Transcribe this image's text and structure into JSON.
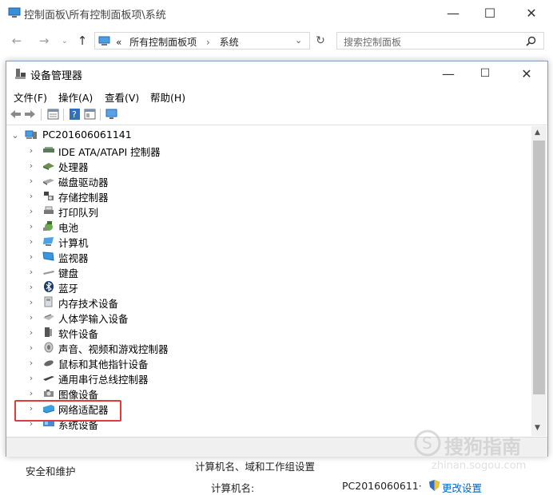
{
  "outer_window": {
    "title": "控制面板\\所有控制面板项\\系统",
    "address": {
      "prefix": "«",
      "crumb1": "所有控制面板项",
      "sep": "›",
      "crumb2": "系统"
    },
    "search_placeholder": "搜索控制面板"
  },
  "device_manager": {
    "title": "设备管理器",
    "menu": [
      "文件(F)",
      "操作(A)",
      "查看(V)",
      "帮助(H)"
    ],
    "tree": {
      "root": "PC201606061141",
      "items": [
        {
          "label": "IDE ATA/ATAPI 控制器",
          "icon": "ide-controller-icon"
        },
        {
          "label": "处理器",
          "icon": "processor-icon"
        },
        {
          "label": "磁盘驱动器",
          "icon": "disk-drive-icon"
        },
        {
          "label": "存储控制器",
          "icon": "storage-controller-icon"
        },
        {
          "label": "打印队列",
          "icon": "print-queue-icon"
        },
        {
          "label": "电池",
          "icon": "battery-icon"
        },
        {
          "label": "计算机",
          "icon": "computer-icon"
        },
        {
          "label": "监视器",
          "icon": "monitor-icon"
        },
        {
          "label": "键盘",
          "icon": "keyboard-icon"
        },
        {
          "label": "蓝牙",
          "icon": "bluetooth-icon"
        },
        {
          "label": "内存技术设备",
          "icon": "memory-device-icon"
        },
        {
          "label": "人体学输入设备",
          "icon": "hid-icon"
        },
        {
          "label": "软件设备",
          "icon": "software-device-icon"
        },
        {
          "label": "声音、视频和游戏控制器",
          "icon": "sound-icon"
        },
        {
          "label": "鼠标和其他指针设备",
          "icon": "mouse-icon"
        },
        {
          "label": "通用串行总线控制器",
          "icon": "usb-icon"
        },
        {
          "label": "图像设备",
          "icon": "imaging-device-icon"
        },
        {
          "label": "网络适配器",
          "icon": "network-adapter-icon"
        },
        {
          "label": "系统设备",
          "icon": "system-device-icon"
        }
      ]
    },
    "highlighted_item": "网络适配器"
  },
  "background": {
    "security_link": "安全和维护",
    "section_heading": "计算机名、域和工作组设置",
    "computer_name_label": "计算机名:",
    "computer_name_value": "PC2016060611·",
    "change_settings": "更改设置"
  },
  "watermark": {
    "brand": "搜狗指南",
    "url": "zhinan.sogou.com"
  },
  "colors": {
    "highlight_border": "#e03a3a",
    "link_blue": "#0066cc",
    "scrollbar_thumb": "#c2c2c2"
  }
}
